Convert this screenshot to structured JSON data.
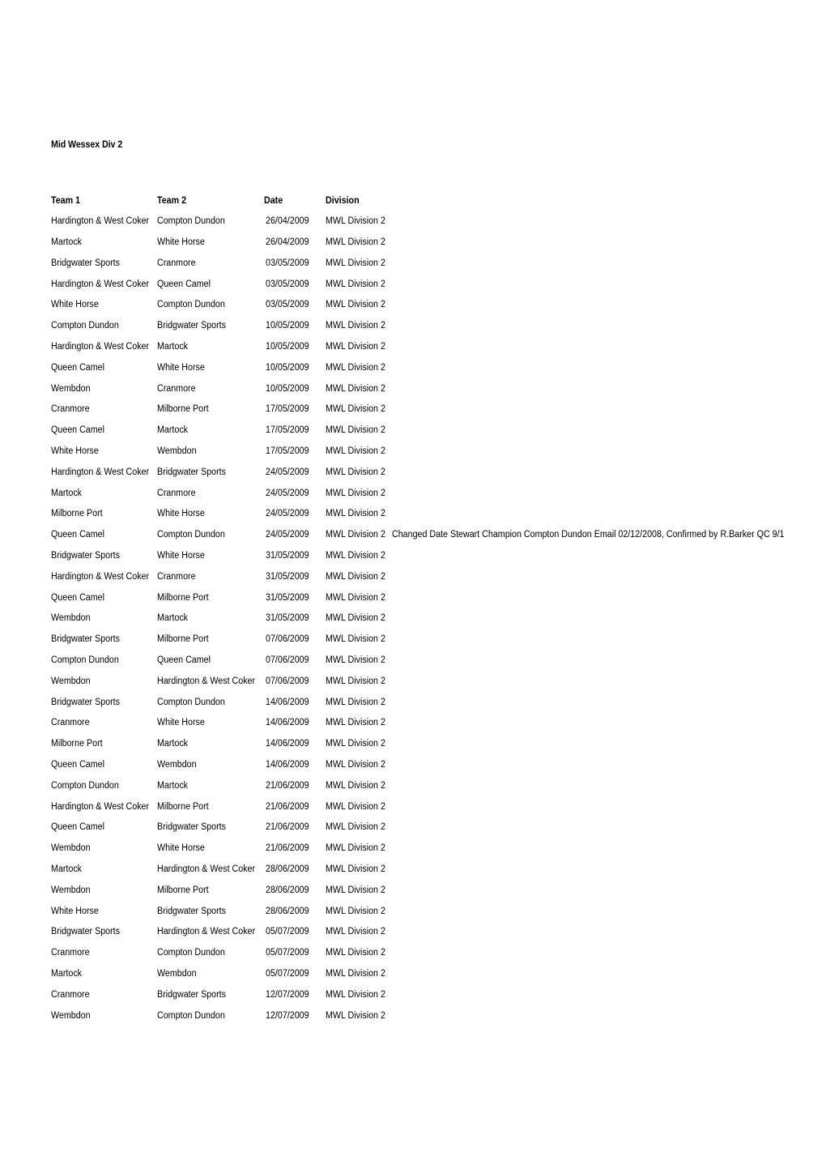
{
  "document": {
    "title": "Mid Wessex Div 2"
  },
  "table": {
    "columns": [
      "Team 1",
      "Team 2",
      "Date",
      "Division"
    ],
    "rows": [
      {
        "team1": "Hardington & West Coker",
        "team2": "Compton Dundon",
        "date": "26/04/2009",
        "division": "MWL Division 2",
        "note": ""
      },
      {
        "team1": "Martock",
        "team2": "White Horse",
        "date": "26/04/2009",
        "division": "MWL Division 2",
        "note": ""
      },
      {
        "team1": "Bridgwater Sports",
        "team2": "Cranmore",
        "date": "03/05/2009",
        "division": "MWL Division 2",
        "note": ""
      },
      {
        "team1": "Hardington & West Coker",
        "team2": "Queen Camel",
        "date": "03/05/2009",
        "division": "MWL Division 2",
        "note": ""
      },
      {
        "team1": "White Horse",
        "team2": "Compton Dundon",
        "date": "03/05/2009",
        "division": "MWL Division 2",
        "note": ""
      },
      {
        "team1": "Compton Dundon",
        "team2": "Bridgwater Sports",
        "date": "10/05/2009",
        "division": "MWL Division 2",
        "note": ""
      },
      {
        "team1": "Hardington & West Coker",
        "team2": "Martock",
        "date": "10/05/2009",
        "division": "MWL Division 2",
        "note": ""
      },
      {
        "team1": "Queen Camel",
        "team2": "White Horse",
        "date": "10/05/2009",
        "division": "MWL Division 2",
        "note": ""
      },
      {
        "team1": "Wembdon",
        "team2": "Cranmore",
        "date": "10/05/2009",
        "division": "MWL Division 2",
        "note": ""
      },
      {
        "team1": "Cranmore",
        "team2": "Milborne Port",
        "date": "17/05/2009",
        "division": "MWL Division 2",
        "note": ""
      },
      {
        "team1": "Queen Camel",
        "team2": "Martock",
        "date": "17/05/2009",
        "division": "MWL Division 2",
        "note": ""
      },
      {
        "team1": "White Horse",
        "team2": "Wembdon",
        "date": "17/05/2009",
        "division": "MWL Division 2",
        "note": ""
      },
      {
        "team1": "Hardington & West Coker",
        "team2": "Bridgwater Sports",
        "date": "24/05/2009",
        "division": "MWL Division 2",
        "note": ""
      },
      {
        "team1": "Martock",
        "team2": "Cranmore",
        "date": "24/05/2009",
        "division": "MWL Division 2",
        "note": ""
      },
      {
        "team1": "Milborne Port",
        "team2": "White Horse",
        "date": "24/05/2009",
        "division": "MWL Division 2",
        "note": ""
      },
      {
        "team1": "Queen Camel",
        "team2": "Compton Dundon",
        "date": "24/05/2009",
        "division": "MWL Division 2",
        "note": "Changed Date Stewart Champion Compton Dundon Email 02/12/2008, Confirmed by R.Barker QC 9/1"
      },
      {
        "team1": "Bridgwater Sports",
        "team2": "White Horse",
        "date": "31/05/2009",
        "division": "MWL Division 2",
        "note": ""
      },
      {
        "team1": "Hardington & West Coker",
        "team2": "Cranmore",
        "date": "31/05/2009",
        "division": "MWL Division 2",
        "note": ""
      },
      {
        "team1": "Queen Camel",
        "team2": "Milborne Port",
        "date": "31/05/2009",
        "division": "MWL Division 2",
        "note": ""
      },
      {
        "team1": "Wembdon",
        "team2": "Martock",
        "date": "31/05/2009",
        "division": "MWL Division 2",
        "note": ""
      },
      {
        "team1": "Bridgwater Sports",
        "team2": "Milborne Port",
        "date": "07/06/2009",
        "division": "MWL Division 2",
        "note": ""
      },
      {
        "team1": "Compton Dundon",
        "team2": "Queen Camel",
        "date": "07/06/2009",
        "division": "MWL Division 2",
        "note": ""
      },
      {
        "team1": "Wembdon",
        "team2": "Hardington & West Coker",
        "date": "07/06/2009",
        "division": "MWL Division 2",
        "note": ""
      },
      {
        "team1": "Bridgwater Sports",
        "team2": "Compton Dundon",
        "date": "14/06/2009",
        "division": "MWL Division 2",
        "note": ""
      },
      {
        "team1": "Cranmore",
        "team2": "White Horse",
        "date": "14/06/2009",
        "division": "MWL Division 2",
        "note": ""
      },
      {
        "team1": "Milborne Port",
        "team2": "Martock",
        "date": "14/06/2009",
        "division": "MWL Division 2",
        "note": ""
      },
      {
        "team1": "Queen Camel",
        "team2": "Wembdon",
        "date": "14/06/2009",
        "division": "MWL Division 2",
        "note": ""
      },
      {
        "team1": "Compton Dundon",
        "team2": "Martock",
        "date": "21/06/2009",
        "division": "MWL Division 2",
        "note": ""
      },
      {
        "team1": "Hardington & West Coker",
        "team2": "Milborne Port",
        "date": "21/06/2009",
        "division": "MWL Division 2",
        "note": ""
      },
      {
        "team1": "Queen Camel",
        "team2": "Bridgwater Sports",
        "date": "21/06/2009",
        "division": "MWL Division 2",
        "note": ""
      },
      {
        "team1": "Wembdon",
        "team2": "White Horse",
        "date": "21/06/2009",
        "division": "MWL Division 2",
        "note": ""
      },
      {
        "team1": "Martock",
        "team2": "Hardington & West Coker",
        "date": "28/06/2009",
        "division": "MWL Division 2",
        "note": ""
      },
      {
        "team1": "Wembdon",
        "team2": "Milborne Port",
        "date": "28/06/2009",
        "division": "MWL Division 2",
        "note": ""
      },
      {
        "team1": "White Horse",
        "team2": "Bridgwater Sports",
        "date": "28/06/2009",
        "division": "MWL Division 2",
        "note": ""
      },
      {
        "team1": "Bridgwater Sports",
        "team2": "Hardington & West Coker",
        "date": "05/07/2009",
        "division": "MWL Division 2",
        "note": ""
      },
      {
        "team1": "Cranmore",
        "team2": "Compton Dundon",
        "date": "05/07/2009",
        "division": "MWL Division 2",
        "note": ""
      },
      {
        "team1": "Martock",
        "team2": "Wembdon",
        "date": "05/07/2009",
        "division": "MWL Division 2",
        "note": ""
      },
      {
        "team1": "Cranmore",
        "team2": "Bridgwater Sports",
        "date": "12/07/2009",
        "division": "MWL Division 2",
        "note": ""
      },
      {
        "team1": "Wembdon",
        "team2": "Compton Dundon",
        "date": "12/07/2009",
        "division": "MWL Division 2",
        "note": ""
      }
    ]
  }
}
